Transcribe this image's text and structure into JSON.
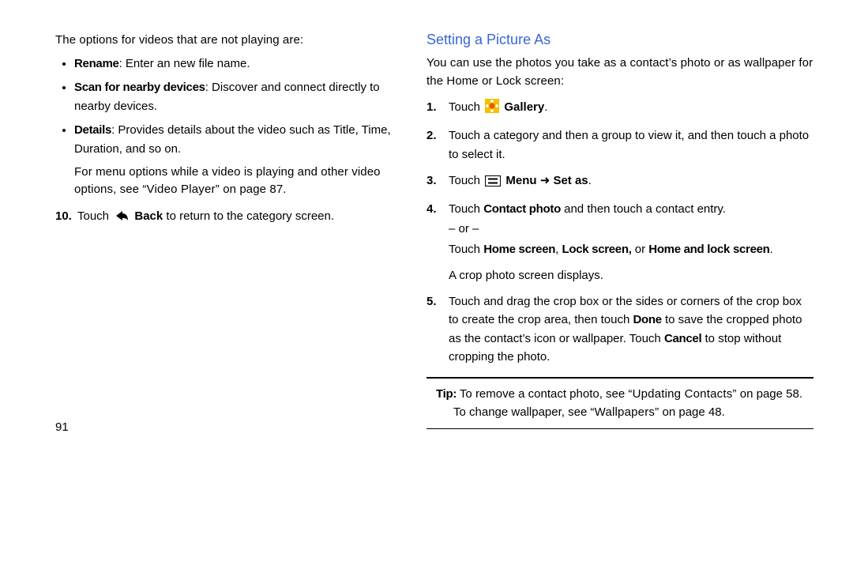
{
  "left": {
    "intro": "The options for videos that are not playing are:",
    "bullets": {
      "rename_bold": "Rename",
      "rename_rest": ": Enter an new file name.",
      "scan_bold": "Scan for nearby devices",
      "scan_rest": ": Discover and connect directly to nearby devices.",
      "details_bold": "Details",
      "details_rest": ": Provides details about the video such as Title, Time, Duration, and so on."
    },
    "menu_hint_pre": "For menu options while a video is playing and other video options, see ",
    "menu_hint_quote": "“Video Player”",
    "menu_hint_post": " on page 87.",
    "step10_num": "10.",
    "step10_pre": "Touch ",
    "step10_back": " Back",
    "step10_post": " to return to the category screen."
  },
  "right": {
    "heading": "Setting a Picture As",
    "intro": "You can use the photos you take as a contact’s photo or as wallpaper for the Home or Lock screen:",
    "step1_num": "1.",
    "step1_pre": "Touch ",
    "step1_gallery": " Gallery",
    "step1_post": ".",
    "step2_num": "2.",
    "step2_text": "Touch a category and then a group to view it, and then touch a photo to select it.",
    "step3_num": "3.",
    "step3_pre": "Touch ",
    "step3_menu": " Menu",
    "step3_arrow": " ➜ ",
    "step3_setas": "Set as",
    "step3_post": ".",
    "step4_num": "4.",
    "step4_l1_pre": "Touch ",
    "step4_l1_bold": "Contact photo",
    "step4_l1_post": " and then touch a contact entry.",
    "step4_or": "– or –",
    "step4_l3_pre": "Touch ",
    "step4_l3_b1": "Home screen",
    "step4_l3_mid1": ", ",
    "step4_l3_b2": "Lock screen,",
    "step4_l3_mid2": " or ",
    "step4_l3_b3": "Home and lock screen",
    "step4_l3_post": ".",
    "step4_crop": "A crop photo screen displays.",
    "step5_num": "5.",
    "step5_pre": "Touch and drag the crop box or the sides or corners of the crop box to create the crop area, then touch ",
    "step5_done": "Done",
    "step5_mid": " to save the cropped photo as the contact’s icon or wallpaper. Touch ",
    "step5_cancel": "Cancel",
    "step5_post": " to stop without cropping the photo.",
    "tip_bold": "Tip:",
    "tip_pre": " To remove a contact photo, see ",
    "tip_quote": "“Updating Contacts”",
    "tip_post": " on page 58.",
    "tip2_pre": "To change wallpaper, see ",
    "tip2_quote": "“Wallpapers”",
    "tip2_post": " on page 48."
  },
  "page_number": "91"
}
